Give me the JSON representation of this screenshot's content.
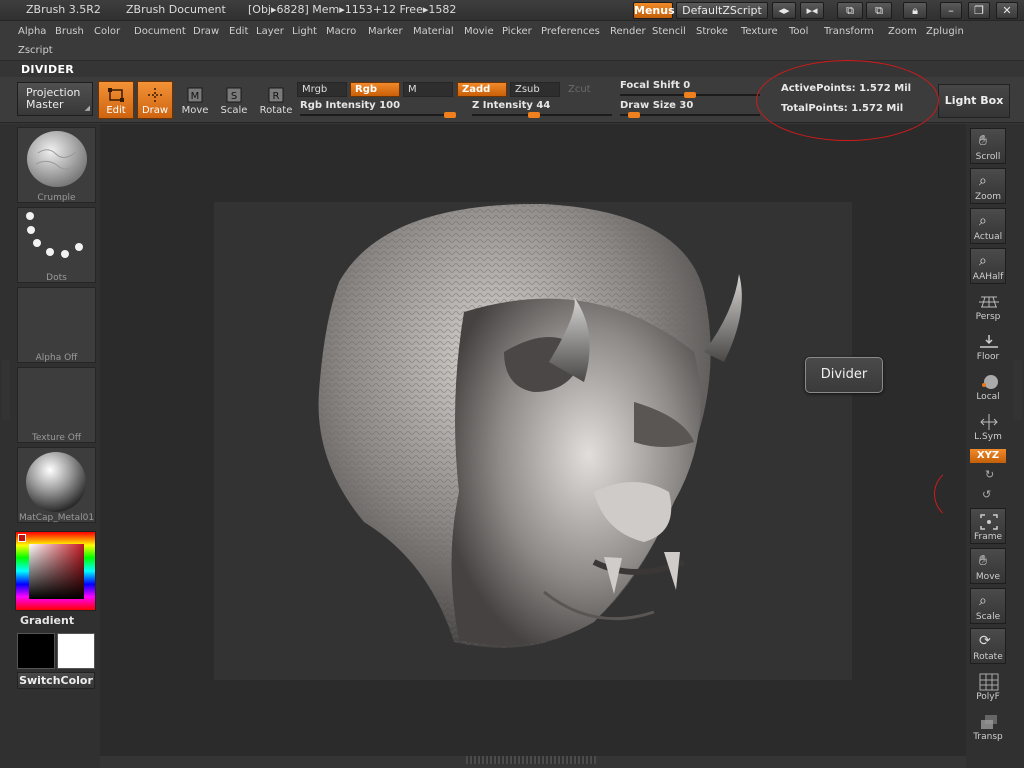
{
  "titlebar": {
    "app_name": "ZBrush 3.5R2",
    "document": "ZBrush Document",
    "obj_info": "[Obj▸6828] Mem▸1153+12 Free▸1582",
    "menus_btn": "Menus",
    "zscript_btn": "DefaultZScript"
  },
  "menubar": {
    "items": [
      "Alpha",
      "Brush",
      "Color",
      "Document",
      "Draw",
      "Edit",
      "Layer",
      "Light",
      "Macro",
      "Marker",
      "Material",
      "Movie",
      "Picker",
      "Preferences",
      "Render",
      "Stencil",
      "Stroke",
      "Texture",
      "Tool",
      "Transform",
      "Zoom",
      "Zplugin"
    ],
    "second_row": [
      "Zscript"
    ]
  },
  "palette_title": "DIVIDER",
  "toolbar": {
    "projection_master": [
      "Projection",
      "Master"
    ],
    "edit": "Edit",
    "draw": "Draw",
    "move": "Move",
    "scale": "Scale",
    "rotate": "Rotate",
    "mrgb": "Mrgb",
    "rgb": "Rgb",
    "m": "M",
    "zadd": "Zadd",
    "zsub": "Zsub",
    "zcut": "Zcut",
    "rgb_intensity": {
      "label": "Rgb  Intensity",
      "value": "100",
      "level": 1.0
    },
    "z_intensity": {
      "label": "Z  Intensity",
      "value": "44",
      "level": 0.44
    },
    "focal_shift": {
      "label": "Focal  Shift",
      "value": "0",
      "level": 0.5
    },
    "draw_size": {
      "label": "Draw  Size",
      "value": "30",
      "level": 0.1
    },
    "active_points": "ActivePoints: 1.572  Mil",
    "total_points": "TotalPoints: 1.572  Mil",
    "light_box": "Light  Box"
  },
  "left_panel": {
    "brush": "Crumple",
    "stroke": "Dots",
    "alpha": "Alpha  Off",
    "texture": "Texture  Off",
    "material": "MatCap_Metal01",
    "gradient": "Gradient",
    "switch_color": "SwitchColor",
    "primary_color": "#000000",
    "secondary_color": "#ffffff"
  },
  "canvas": {
    "tooltip": "Divider"
  },
  "right_panel": {
    "buttons": [
      "Scroll",
      "Zoom",
      "Actual",
      "AAHalf",
      "Persp",
      "Floor",
      "Local",
      "L.Sym",
      "Frame",
      "Move",
      "Scale",
      "Rotate",
      "PolyF",
      "Transp"
    ],
    "xyz": "XYZ"
  },
  "colors": {
    "accent": "#e8781a",
    "annotation": "#d11a1a"
  }
}
